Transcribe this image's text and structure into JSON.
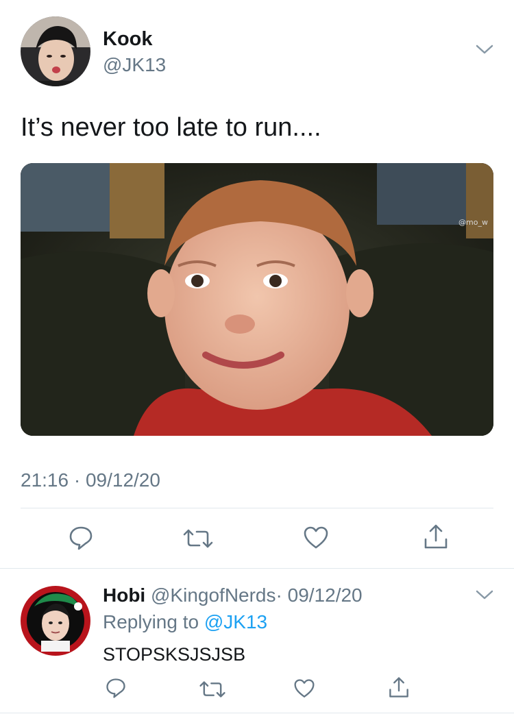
{
  "tweet": {
    "author_name": "Kook",
    "author_handle": "@JK13",
    "text": "It’s never too late to run....",
    "image_watermark": "@mo_w",
    "timestamp": "21:16 · 09/12/20",
    "actions": {
      "reply_icon": "reply-icon",
      "retweet_icon": "retweet-icon",
      "like_icon": "heart-icon",
      "share_icon": "share-icon"
    }
  },
  "reply": {
    "author_name": "Hobi",
    "author_handle": "@KingofNerds",
    "date": "· 09/12/20",
    "replying_prefix": "Replying to",
    "replying_handle": "@JK13",
    "text": "STOPSKSJSJSB"
  },
  "colors": {
    "primary_text": "#14171a",
    "secondary_text": "#657786",
    "link": "#1da1f2",
    "icon": "#657786",
    "divider": "#e1e8ed"
  }
}
